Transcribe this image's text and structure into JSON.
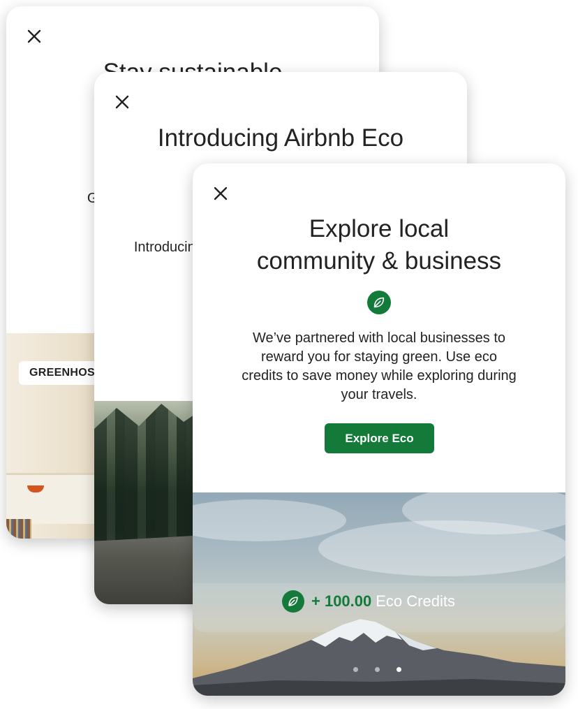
{
  "cards": [
    {
      "title": "Stay sustainable",
      "body": "Green stays, saving travelers fees",
      "tag": "GREENHOST",
      "close_icon": "close-icon"
    },
    {
      "title": "Introducing Airbnb Eco",
      "body": "Introducing a new way to travel sustainably and save",
      "close_icon": "close-icon"
    },
    {
      "title_line1": "Explore local",
      "title_line2": "community & business",
      "body": "We’ve partnered with local businesses to reward you for staying green. Use eco credits to save money while exploring during your travels.",
      "cta_label": "Explore Eco",
      "credits_amount": "+ 100.00",
      "credits_label": "Eco Credits",
      "leaf_icon": "leaf-icon",
      "close_icon": "close-icon",
      "pagination": {
        "total": 3,
        "active_index": 2
      }
    }
  ],
  "colors": {
    "accent": "#137a3a",
    "text": "#222222"
  }
}
